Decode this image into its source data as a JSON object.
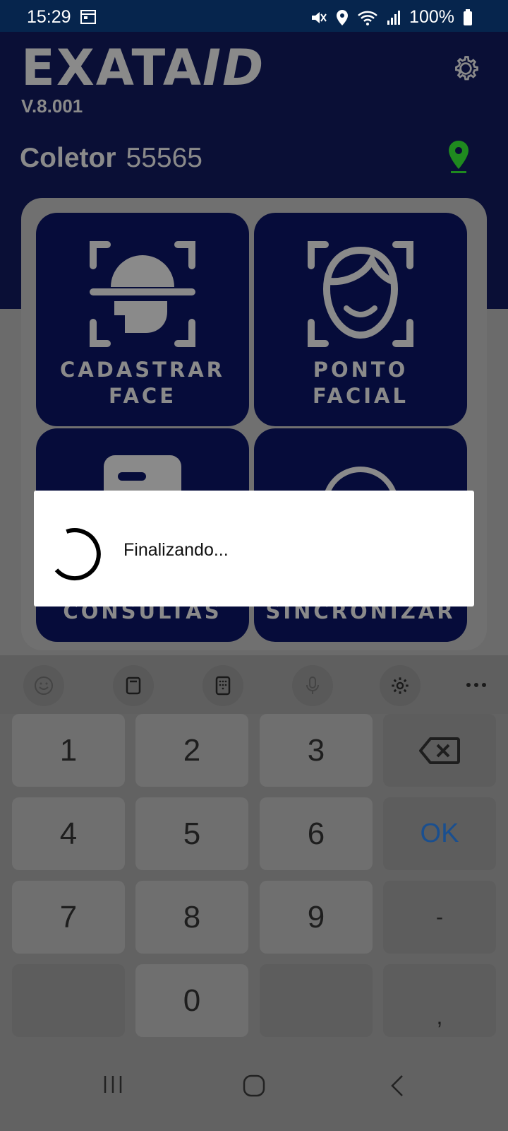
{
  "status": {
    "time": "15:29",
    "battery": "100%"
  },
  "app": {
    "brand_main": "EXATA",
    "brand_suffix": "ID",
    "version": "V.8.001",
    "collector_label": "Coletor",
    "collector_id": "55565"
  },
  "tiles": [
    {
      "line1": "CADASTRAR",
      "line2": "FACE"
    },
    {
      "line1": "PONTO",
      "line2": "FACIAL"
    },
    {
      "line1": "CONSULTAS",
      "line2": ""
    },
    {
      "line1": "SINCRONIZAR",
      "line2": ""
    }
  ],
  "dialog": {
    "message": "Finalizando..."
  },
  "keyboard": {
    "keys": [
      "1",
      "2",
      "3",
      "4",
      "5",
      "6",
      "OK",
      "7",
      "8",
      "9",
      "-",
      "0",
      ","
    ]
  },
  "colors": {
    "header_bg": "#0a0f36",
    "status_bg": "#06254d",
    "tile_bg": "#060c3a",
    "pin_green": "#1f8a1f",
    "ok_blue": "#1a4f8f"
  }
}
